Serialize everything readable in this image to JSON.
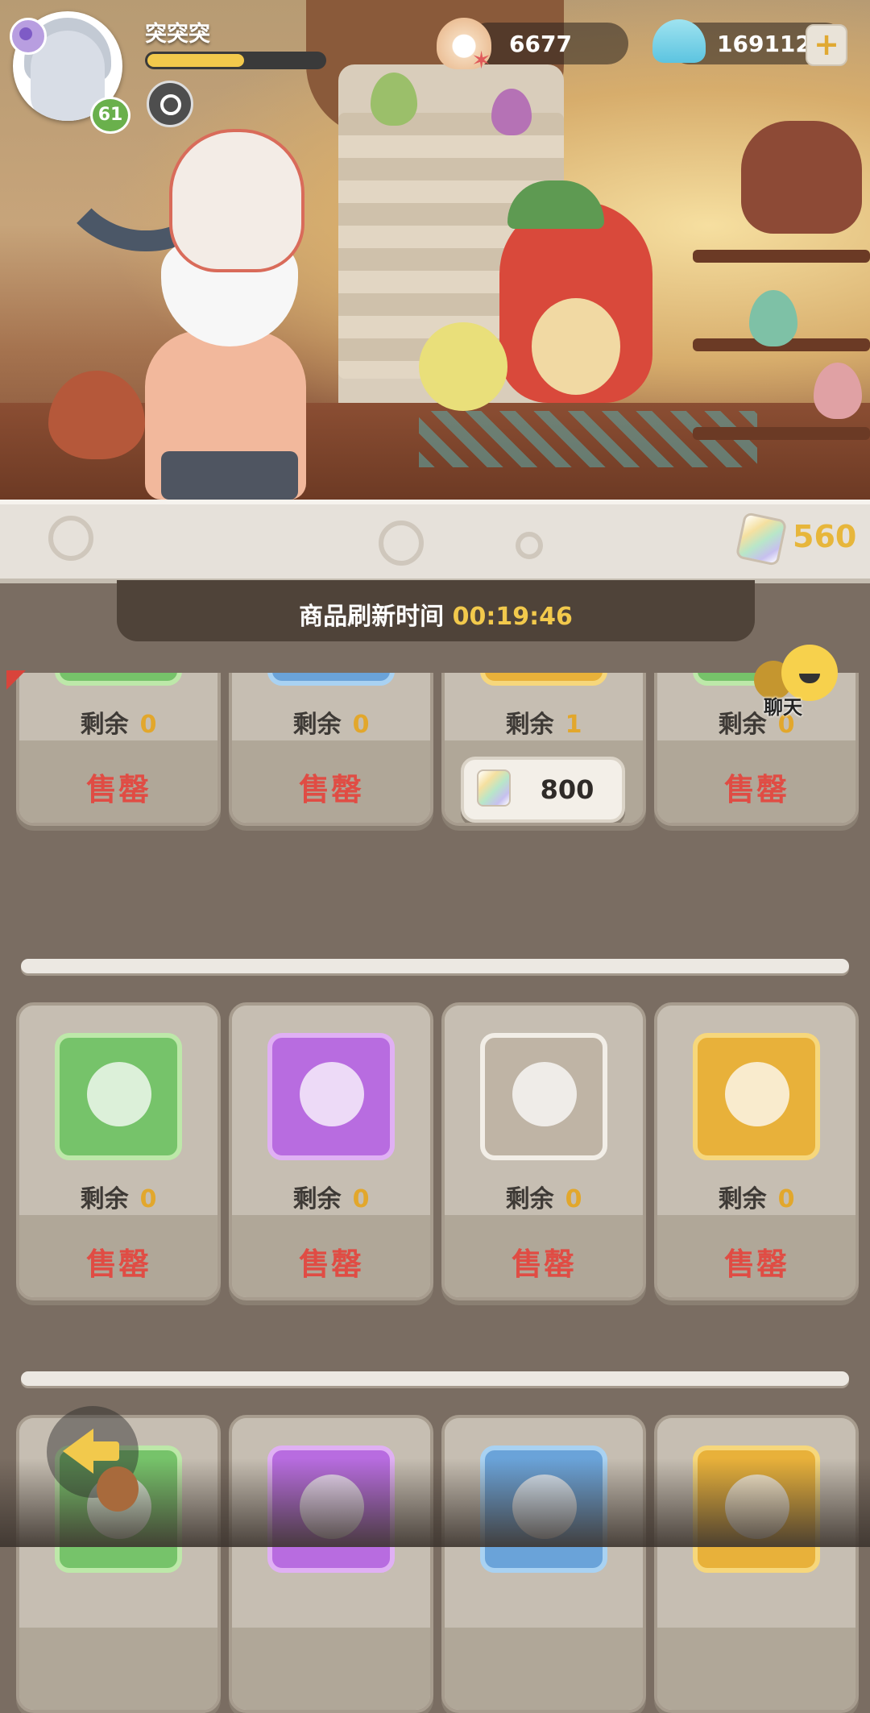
{
  "player": {
    "name": "突突突",
    "level": "61",
    "xp_fraction": 0.55
  },
  "currency": {
    "pearls": "6677",
    "shells": "169112"
  },
  "shop": {
    "gems": "560",
    "refresh_label": "商品刷新时间",
    "refresh_time": "00:19:46"
  },
  "chat": {
    "label": "聊天"
  },
  "labels": {
    "remaining": "剩余",
    "sold_out": "售罄"
  },
  "rows": [
    {
      "items": [
        {
          "frame": "green",
          "icon": "pink-flower-icon",
          "remaining": "0",
          "sold_out": true
        },
        {
          "frame": "blue",
          "icon": "life-ring-icon",
          "remaining": "0",
          "sold_out": true
        },
        {
          "frame": "gold",
          "icon": "dino-statue-icon",
          "remaining": "1",
          "sold_out": false,
          "price": "800"
        },
        {
          "frame": "green",
          "icon": "leaf-charm-icon",
          "remaining": "0",
          "sold_out": true
        }
      ]
    },
    {
      "items": [
        {
          "frame": "green",
          "icon": "hearts-icon",
          "remaining": "0",
          "sold_out": true
        },
        {
          "frame": "purple",
          "icon": "monster-statue-icon",
          "remaining": "0",
          "sold_out": true
        },
        {
          "frame": "gray",
          "icon": "blue-wing-icon",
          "remaining": "0",
          "sold_out": true
        },
        {
          "frame": "gold",
          "icon": "feather-icon",
          "remaining": "0",
          "sold_out": true
        }
      ]
    },
    {
      "items": [
        {
          "frame": "green",
          "icon": "item-icon"
        },
        {
          "frame": "purple",
          "icon": "star-icon"
        },
        {
          "frame": "blue",
          "icon": "cloud-icon"
        },
        {
          "frame": "gold",
          "icon": "life-ring-icon"
        }
      ]
    }
  ]
}
